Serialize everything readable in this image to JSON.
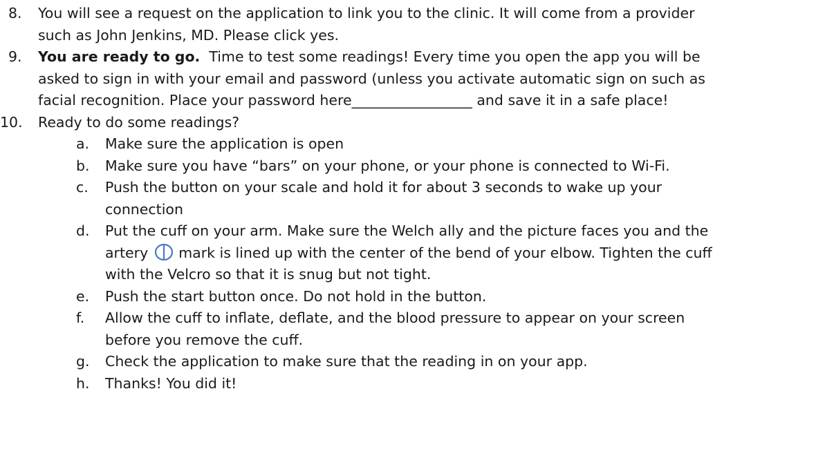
{
  "steps": {
    "s8": {
      "num": "8.",
      "line1": "You will see a request on the application to link you to the clinic. It will come from a provider",
      "line2": "such as John Jenkins, MD. Please click yes."
    },
    "s9": {
      "num": "9.",
      "bold": "You are ready to go.",
      "line1_rest": "  Time to test some readings! Every time you open the app you will be",
      "line2": "asked to sign in with your email and password (unless you activate automatic sign on such as",
      "line3": "facial recognition. Place your password here_________________ and save it in a safe place!"
    },
    "s10": {
      "num": "10.",
      "line1": "Ready to do some readings?"
    }
  },
  "substeps": {
    "a": {
      "letter": "a.",
      "line1": "Make sure the application is open"
    },
    "b": {
      "letter": "b.",
      "line1": "Make sure you have “bars” on your phone, or your phone is connected to Wi-Fi."
    },
    "c": {
      "letter": "c.",
      "line1": "Push the button on your scale and hold it for about 3 seconds to wake up your",
      "line2": "connection"
    },
    "d": {
      "letter": "d.",
      "line1": "Put the cuff on your arm.  Make sure the Welch ally and the picture faces you and the",
      "line2_pre": "artery",
      "line2_post": "mark is lined up with the center of the bend of your elbow. Tighten the cuff",
      "line3": "with the Velcro so that it is snug but not tight."
    },
    "e": {
      "letter": "e.",
      "line1": "Push the start button once. Do not hold in the button."
    },
    "f": {
      "letter": "f.",
      "line1": "Allow the cuff to inflate, deflate, and the blood pressure to appear on your screen",
      "line2": "before you remove the cuff."
    },
    "g": {
      "letter": "g.",
      "line1": "Check the application to make sure that the reading in on your app."
    },
    "h": {
      "letter": "h.",
      "line1": "Thanks! You did it!"
    }
  },
  "colors": {
    "text": "#1a1a1a",
    "artery_mark": "#4a78c2"
  },
  "icons": {
    "artery_mark": "artery-mark-icon"
  }
}
